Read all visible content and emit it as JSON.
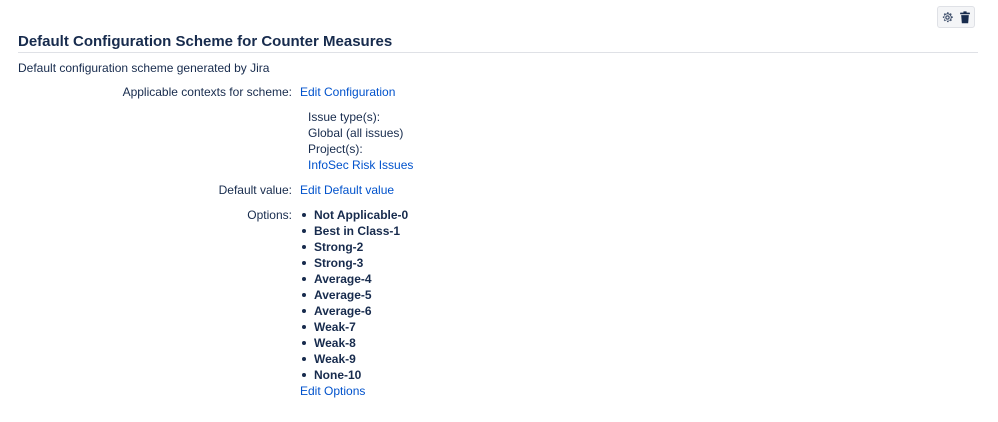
{
  "header": {
    "title": "Default Configuration Scheme for Counter Measures"
  },
  "description": "Default configuration scheme generated by Jira",
  "contexts": {
    "label": "Applicable contexts for scheme:",
    "edit_link": "Edit Configuration",
    "issue_types_label": "Issue type(s):",
    "issue_types_value": "Global (all issues)",
    "projects_label": "Project(s):",
    "project_link": "InfoSec Risk Issues"
  },
  "default_value": {
    "label": "Default value:",
    "edit_link": "Edit Default value"
  },
  "options": {
    "label": "Options:",
    "items": [
      "Not Applicable-0",
      "Best in Class-1",
      "Strong-2",
      "Strong-3",
      "Average-4",
      "Average-5",
      "Average-6",
      "Weak-7",
      "Weak-8",
      "Weak-9",
      "None-10"
    ],
    "edit_link": "Edit Options"
  },
  "icons": {
    "settings": "gear-icon",
    "delete": "trash-icon"
  },
  "colors": {
    "text": "#172b4d",
    "link": "#0052cc",
    "border": "#dfe1e6"
  }
}
